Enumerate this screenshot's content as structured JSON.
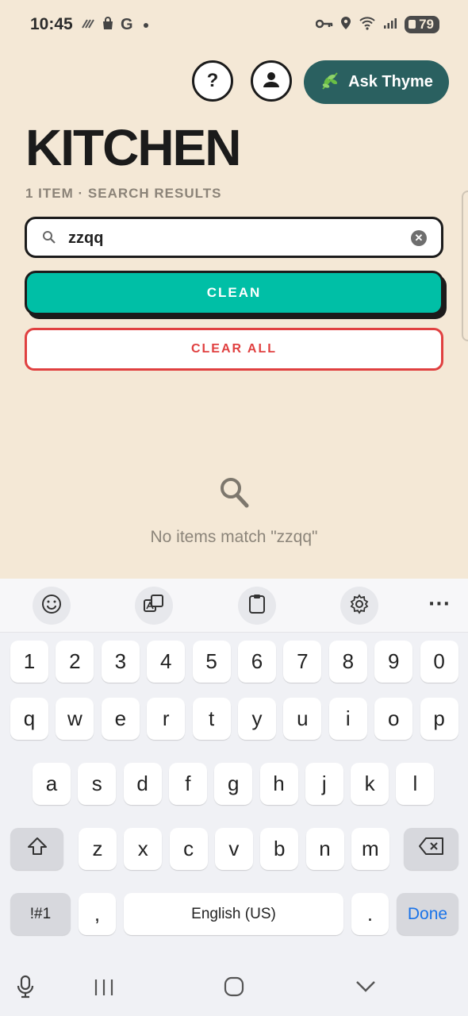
{
  "status_bar": {
    "time": "10:45",
    "battery": "79"
  },
  "header": {
    "help_label": "?",
    "ask_label": "Ask Thyme",
    "title": "KITCHEN",
    "subtitle": "1 ITEM · SEARCH RESULTS"
  },
  "search": {
    "value": "zzqq",
    "placeholder": ""
  },
  "actions": {
    "clean_label": "CLEAN",
    "clear_all_label": "CLEAR ALL"
  },
  "empty_state": {
    "message": "No items match \"zzqq\""
  },
  "keyboard": {
    "row_numbers": [
      "1",
      "2",
      "3",
      "4",
      "5",
      "6",
      "7",
      "8",
      "9",
      "0"
    ],
    "row_top": [
      "q",
      "w",
      "e",
      "r",
      "t",
      "y",
      "u",
      "i",
      "o",
      "p"
    ],
    "row_middle": [
      "a",
      "s",
      "d",
      "f",
      "g",
      "h",
      "j",
      "k",
      "l"
    ],
    "row_bottom": [
      "z",
      "x",
      "c",
      "v",
      "b",
      "n",
      "m"
    ],
    "symbols_label": "!#1",
    "comma_label": ",",
    "space_label": "English (US)",
    "period_label": ".",
    "done_label": "Done",
    "more_label": "···"
  },
  "colors": {
    "background": "#f4e8d6",
    "accent": "#00bfa6",
    "ask_button": "#2a6060",
    "danger": "#e04040"
  }
}
